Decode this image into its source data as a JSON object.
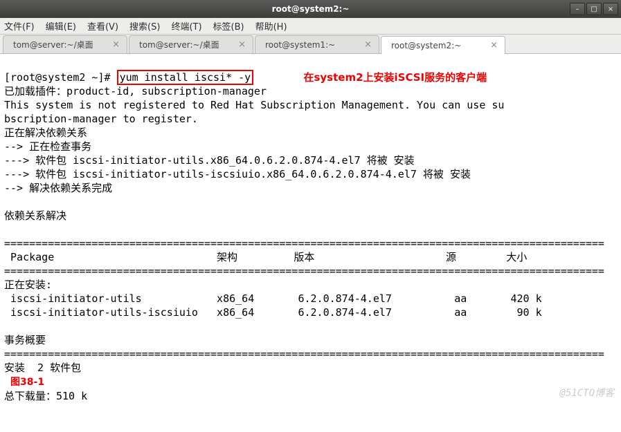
{
  "window": {
    "title": "root@system2:~",
    "min_label": "–",
    "max_label": "□",
    "close_label": "×"
  },
  "menu": {
    "file": "文件(F)",
    "edit": "编辑(E)",
    "view": "查看(V)",
    "search": "搜索(S)",
    "terminal": "终端(T)",
    "tabs": "标签(B)",
    "help": "帮助(H)"
  },
  "tabs": [
    {
      "label": "tom@server:~/桌面",
      "active": false
    },
    {
      "label": "tom@server:~/桌面",
      "active": false
    },
    {
      "label": "root@system1:~",
      "active": false
    },
    {
      "label": "root@system2:~",
      "active": true
    }
  ],
  "term": {
    "prompt": "[root@system2 ~]# ",
    "command": "yum install iscsi* -y",
    "annotation": "在system2上安装iSCSI服务的客户端",
    "line_plugins": "已加载插件：product-id, subscription-manager",
    "line_not_registered": "This system is not registered to Red Hat Subscription Management. You can use su",
    "line_not_registered2": "bscription-manager to register.",
    "line_resolving": "正在解决依赖关系",
    "line_checking": "--> 正在检查事务",
    "line_pkg1": "---> 软件包 iscsi-initiator-utils.x86_64.0.6.2.0.874-4.el7 将被 安装",
    "line_pkg2": "---> 软件包 iscsi-initiator-utils-iscsiuio.x86_64.0.6.2.0.874-4.el7 将被 安装",
    "line_depdone": "--> 解决依赖关系完成",
    "line_depresolved": "依赖关系解决",
    "sep": "================================================================================================",
    "header": " Package                          架构         版本                     源        大小",
    "installing_hdr": "正在安装:",
    "row1": " iscsi-initiator-utils            x86_64       6.2.0.874-4.el7          aa       420 k",
    "row2": " iscsi-initiator-utils-iscsiuio   x86_64       6.2.0.874-4.el7          aa        90 k",
    "summary_hdr": "事务概要",
    "install_count": "安装  2 软件包",
    "figure_label": "图38-1",
    "total_dl": "总下载量：510 k"
  },
  "watermark": "@51CTO博客"
}
